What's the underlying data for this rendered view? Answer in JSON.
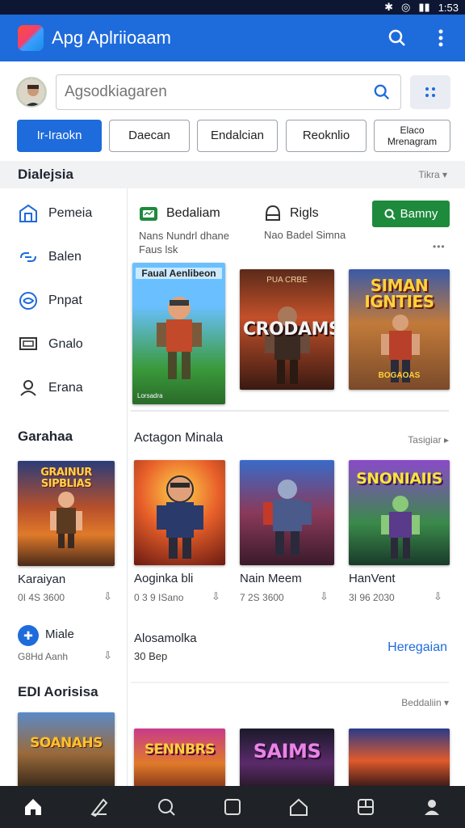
{
  "status": {
    "time": "1:53"
  },
  "app": {
    "title": "Apg Aplriioaam"
  },
  "search": {
    "placeholder": "Agsodkiagaren"
  },
  "chips": [
    {
      "label": "Ir-Iraokn",
      "active": true
    },
    {
      "label": "Daecan",
      "active": false
    },
    {
      "label": "Endalcian",
      "active": false
    },
    {
      "label": "Reoknlio",
      "active": false
    },
    {
      "label": "Elaco\nMrenagram",
      "active": false
    }
  ],
  "section": {
    "title": "Dialejsia",
    "more": "Tikra ▾"
  },
  "sidebar": {
    "items": [
      {
        "label": "Pemeia",
        "icon": "building-icon"
      },
      {
        "label": "Balen",
        "icon": "link-icon"
      },
      {
        "label": "Pnpat",
        "icon": "globe-icon"
      },
      {
        "label": "Gnalo",
        "icon": "monitor-icon"
      },
      {
        "label": "Erana",
        "icon": "person-icon"
      }
    ],
    "heading_1": "Garahaa",
    "tile": {
      "title": "GRAINUR\nSIPBLIAS",
      "name": "Karaiyan",
      "meta": "0I 4S 3600"
    },
    "badge": {
      "label": "Miale",
      "meta": "G8Hd Aanh"
    },
    "heading_2": "EDI Aorisisa",
    "tile2": {
      "title": "SOANAHS"
    }
  },
  "featured": {
    "left_label": "Bedaliam",
    "left_sub": "Nans Nundrl dhane\nFaus lsk",
    "right_label": "Rigls",
    "right_sub": "Nao Badel Simna",
    "button": "Bamny",
    "more": "•••",
    "tiles": [
      {
        "title": "Faual Aenlibeon",
        "tag": "Lorsadra"
      },
      {
        "title": "CRODAMS",
        "tag": "PUA CRBE"
      },
      {
        "title": "SIMAN IGNTIES",
        "tag": "BOGAOAS"
      }
    ]
  },
  "row2": {
    "title": "Actagon Minala",
    "more": "Tasigiar ▸",
    "items": [
      {
        "name": "Aoginka bli",
        "meta": "0 3 9 ISano"
      },
      {
        "name": "Nain Meem",
        "meta": "7 2S 3600"
      },
      {
        "name": "HanVent",
        "meta": "3I 96 2030"
      }
    ],
    "tiles": [
      {
        "title": ""
      },
      {
        "title": ""
      },
      {
        "title": "SNONIAIIS"
      }
    ]
  },
  "row3": {
    "title": "Alosamolka",
    "sub": "30 Bep",
    "link": "Heregaian",
    "more": "Beddaliin ▾",
    "tiles": [
      {
        "title": "SENNBRS"
      },
      {
        "title": "SAIMS"
      },
      {
        "title": ""
      }
    ]
  },
  "colors": {
    "accent": "#1e6bdc",
    "green": "#1e8a3c"
  }
}
